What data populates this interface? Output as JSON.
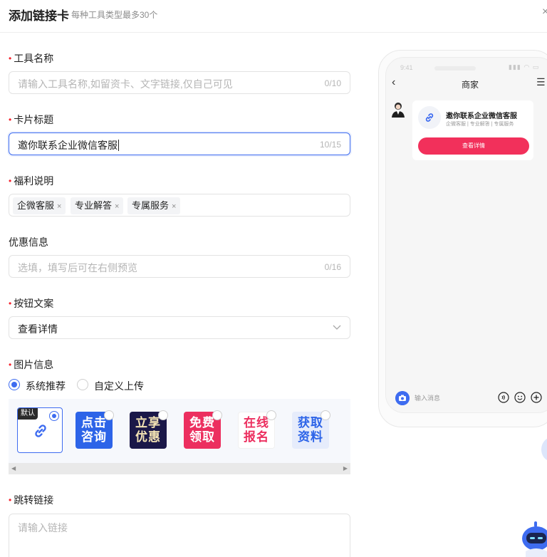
{
  "header": {
    "title": "添加链接卡",
    "subtitle": "每种工具类型最多30个",
    "close": "×"
  },
  "form": {
    "tool_name": {
      "label": "工具名称",
      "placeholder": "请输入工具名称,如留资卡、文字链接,仅自己可见",
      "counter": "0/10"
    },
    "card_title": {
      "label": "卡片标题",
      "value": "邀你联系企业微信客服",
      "counter": "10/15"
    },
    "benefits": {
      "label": "福利说明",
      "tags": [
        "企微客服",
        "专业解答",
        "专属服务"
      ],
      "remove": "×"
    },
    "discount": {
      "label": "优惠信息",
      "placeholder": "选填，填写后可在右侧预览",
      "counter": "0/16"
    },
    "button_text": {
      "label": "按钮文案",
      "value": "查看详情"
    },
    "image_info": {
      "label": "图片信息",
      "options": [
        "系统推荐",
        "自定义上传"
      ],
      "selected": "系统推荐",
      "default_badge": "默认",
      "thumbs": [
        {
          "lines": [],
          "selected": true
        },
        {
          "lines": [
            "点击",
            "咨询"
          ],
          "fg": "#ffffff",
          "bg": "#2d64e8"
        },
        {
          "lines": [
            "立享",
            "优惠"
          ],
          "fg": "#f3e3b4",
          "bg": "#1b1848"
        },
        {
          "lines": [
            "免费",
            "领取"
          ],
          "fg": "#ffffff",
          "bg": "#ec2f5f"
        },
        {
          "lines": [
            "在线",
            "报名"
          ],
          "fg": "#ec2f5f",
          "bg": "#ffffff"
        },
        {
          "lines": [
            "获取",
            "资料"
          ],
          "fg": "#2d64e8",
          "bg": "#e6ecfb"
        }
      ],
      "scroll_left": "◀",
      "scroll_right": "▶"
    },
    "jump_link": {
      "label": "跳转链接",
      "placeholder": "请输入链接"
    },
    "required_mark": "•"
  },
  "preview": {
    "status_time": "9:41",
    "status_icons": "▮▮▮ ◠ ▭",
    "nav_back": "‹",
    "nav_title": "商家",
    "nav_menu": "☰",
    "card": {
      "title": "邀你联系企业微信客服",
      "desc": "企微客服 | 专业解答 | 专属服务",
      "button": "查看详情"
    },
    "chat_placeholder": "输入消息"
  },
  "icons": {
    "close": "close-icon",
    "link": "link-icon",
    "chevron": "chevron-down-icon",
    "camera": "camera-icon",
    "voice": "voice-icon",
    "emoji": "emoji-icon",
    "plus": "plus-circle-icon"
  },
  "colors": {
    "accent": "#3e6cf0",
    "required": "#f5222d",
    "cta": "#f2305b"
  }
}
